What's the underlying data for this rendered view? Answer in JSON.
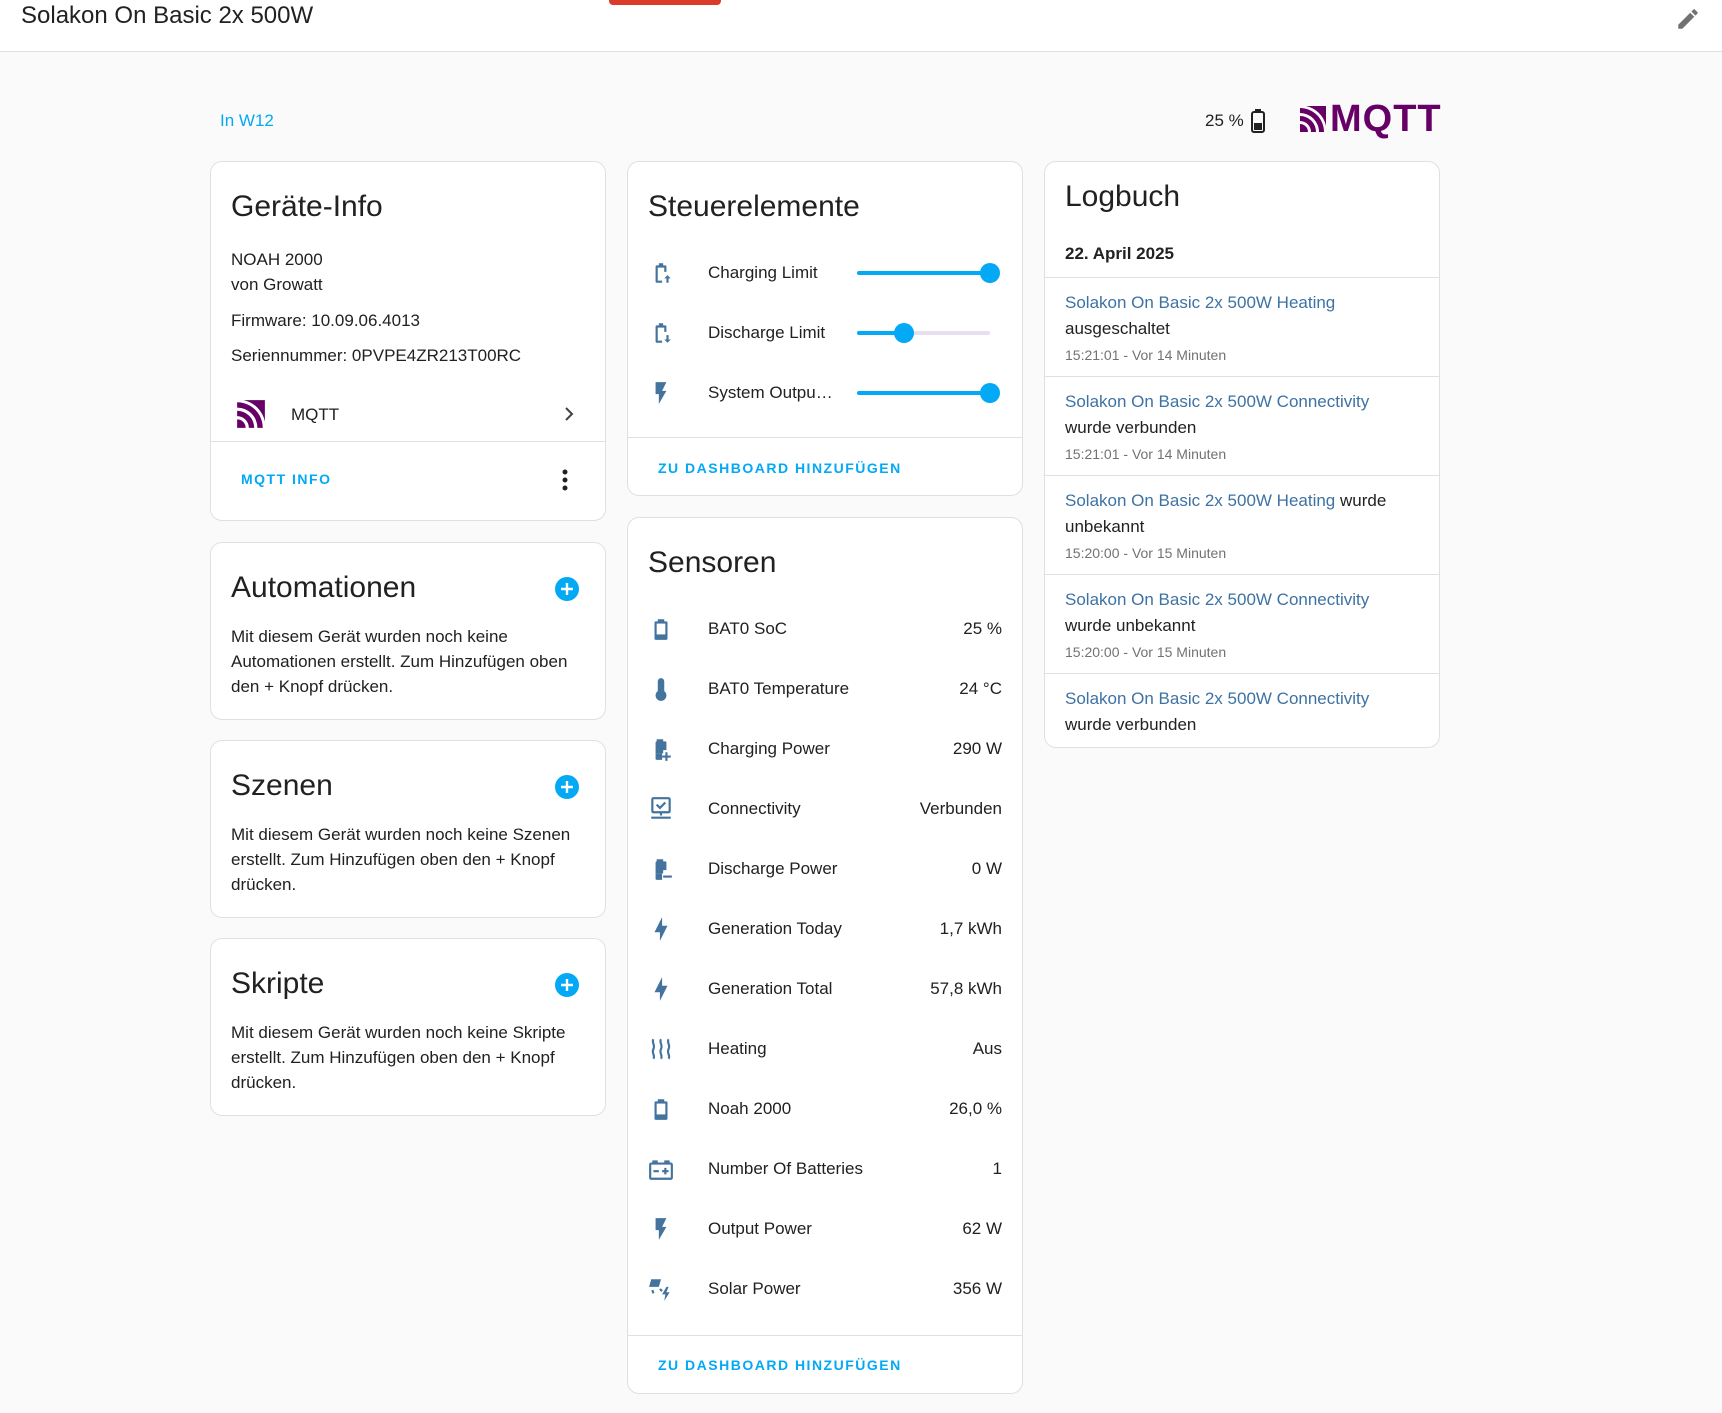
{
  "header": {
    "title": "Solakon On Basic 2x 500W"
  },
  "area_link": "In W12",
  "battery_top": "25 %",
  "integration_logo_text": "MQTT",
  "colors": {
    "accent": "#03a9f4",
    "mqtt_purple": "#660066",
    "log_entity": "#3d72a4",
    "icon": "#44739e"
  },
  "device_info": {
    "title": "Geräte-Info",
    "model": "NOAH 2000",
    "manufacturer": "von Growatt",
    "firmware": "Firmware: 10.09.06.4013",
    "serial": "Seriennummer: 0PVPE4ZR213T00RC",
    "integration": "MQTT",
    "action": "MQTT INFO"
  },
  "automations": {
    "title": "Automationen",
    "text": "Mit diesem Gerät wurden noch keine Automationen erstellt. Zum Hinzufügen oben den + Knopf drücken."
  },
  "scenes": {
    "title": "Szenen",
    "text": "Mit diesem Gerät wurden noch keine Szenen erstellt. Zum Hinzufügen oben den + Knopf drücken."
  },
  "scripts": {
    "title": "Skripte",
    "text": "Mit diesem Gerät wurden noch keine Skripte erstellt. Zum Hinzufügen oben den + Knopf drücken."
  },
  "controls": {
    "title": "Steuerelemente",
    "items": [
      {
        "label": "Charging Limit",
        "icon": "battery-charging-icon",
        "level": 1.0
      },
      {
        "label": "Discharge Limit",
        "icon": "battery-discharging-icon",
        "level": 0.35
      },
      {
        "label": "System Outpu…",
        "icon": "flash-icon",
        "level": 1.0
      }
    ],
    "action": "ZU DASHBOARD HINZUFÜGEN"
  },
  "sensors": {
    "title": "Sensoren",
    "items": [
      {
        "label": "BAT0 SoC",
        "value": "25 %",
        "icon": "battery-icon"
      },
      {
        "label": "BAT0 Temperature",
        "value": "24 °C",
        "icon": "thermometer-icon"
      },
      {
        "label": "Charging Power",
        "value": "290 W",
        "icon": "battery-plus-icon"
      },
      {
        "label": "Connectivity",
        "value": "Verbunden",
        "icon": "network-icon"
      },
      {
        "label": "Discharge Power",
        "value": "0 W",
        "icon": "battery-minus-icon"
      },
      {
        "label": "Generation Today",
        "value": "1,7 kWh",
        "icon": "flash-icon"
      },
      {
        "label": "Generation Total",
        "value": "57,8 kWh",
        "icon": "flash-icon"
      },
      {
        "label": "Heating",
        "value": "Aus",
        "icon": "heat-wave-icon"
      },
      {
        "label": "Noah 2000",
        "value": "26,0 %",
        "icon": "battery-icon"
      },
      {
        "label": "Number Of Batteries",
        "value": "1",
        "icon": "car-battery-icon"
      },
      {
        "label": "Output Power",
        "value": "62 W",
        "icon": "flash-icon"
      },
      {
        "label": "Solar Power",
        "value": "356 W",
        "icon": "solar-power-icon"
      }
    ],
    "action": "ZU DASHBOARD HINZUFÜGEN"
  },
  "logbook": {
    "title": "Logbuch",
    "date": "22. April 2025",
    "entries": [
      {
        "entity": "Solakon On Basic 2x 500W Heating",
        "message": "ausgeschaltet",
        "time": "15:21:01 - Vor 14 Minuten"
      },
      {
        "entity": "Solakon On Basic 2x 500W Connectivity",
        "message": "wurde verbunden",
        "time": "15:21:01 - Vor 14 Minuten"
      },
      {
        "entity": "Solakon On Basic 2x 500W Heating",
        "message": "wurde unbekannt",
        "time": "15:20:00 - Vor 15 Minuten"
      },
      {
        "entity": "Solakon On Basic 2x 500W Connectivity",
        "message": "wurde unbekannt",
        "time": "15:20:00 - Vor 15 Minuten"
      },
      {
        "entity": "Solakon On Basic 2x 500W Connectivity",
        "message": "wurde verbunden",
        "time": ""
      }
    ]
  }
}
